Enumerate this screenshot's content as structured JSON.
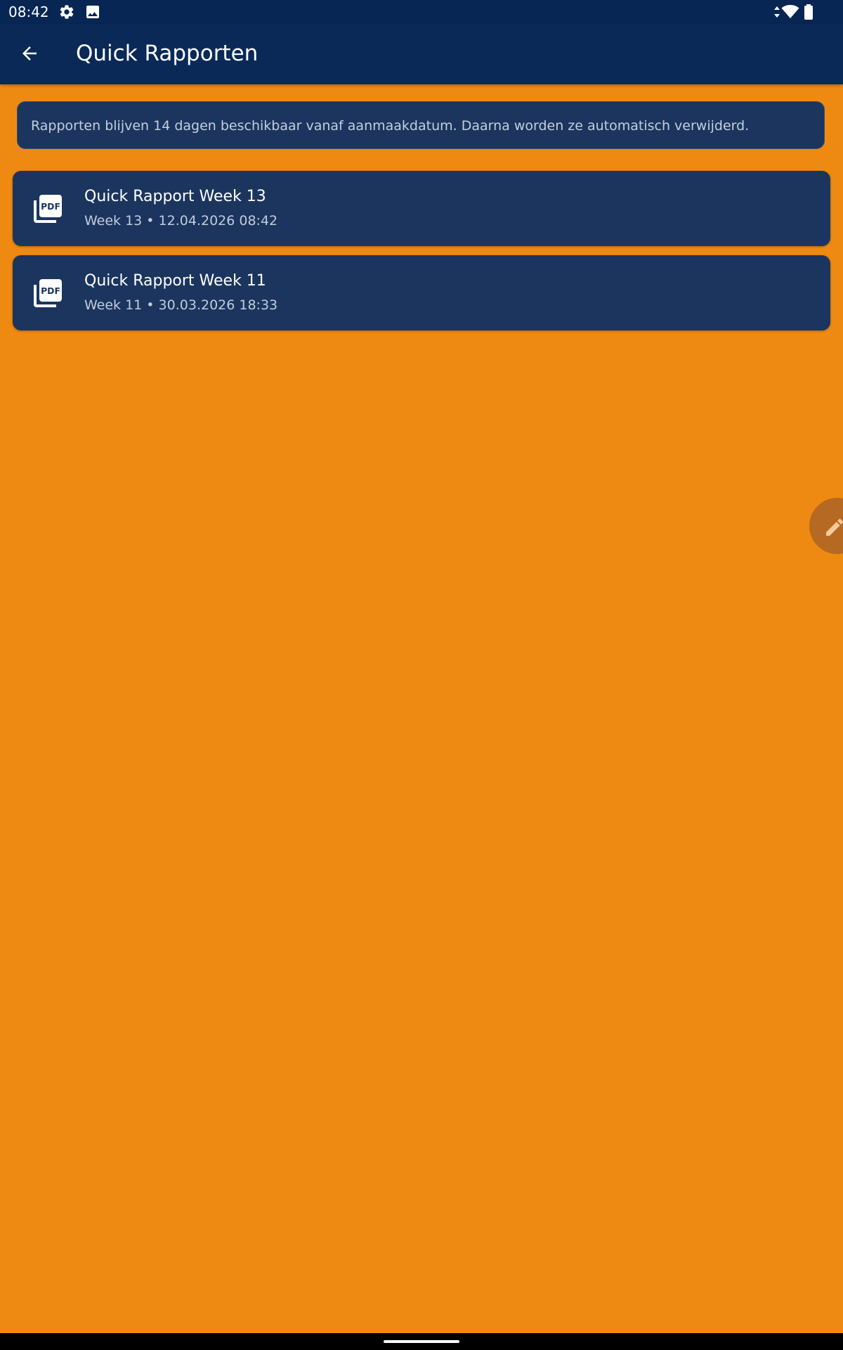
{
  "status_bar": {
    "time": "08:42",
    "icons": [
      "gear-icon",
      "image-icon",
      "data-arrows-icon",
      "wifi-icon",
      "battery-icon"
    ]
  },
  "app_bar": {
    "title": "Quick Rapporten",
    "back_icon": "arrow-left-icon"
  },
  "info_banner": {
    "text": "Rapporten blijven 14 dagen beschikbaar vanaf aanmaakdatum. Daarna worden ze automatisch verwijderd."
  },
  "reports": [
    {
      "title": "Quick Rapport Week 13",
      "subtitle": "Week 13 • 12.04.2026 08:42",
      "icon": "pdf-icon"
    },
    {
      "title": "Quick Rapport Week 11",
      "subtitle": "Week 11 • 30.03.2026 18:33",
      "icon": "pdf-icon"
    }
  ],
  "fab": {
    "icon": "pencil-icon"
  },
  "colors": {
    "background": "#EE8A12",
    "app_bar": "#0A2957",
    "status_bar": "#072653",
    "card": "#1B355F",
    "fab": "#B56922"
  }
}
